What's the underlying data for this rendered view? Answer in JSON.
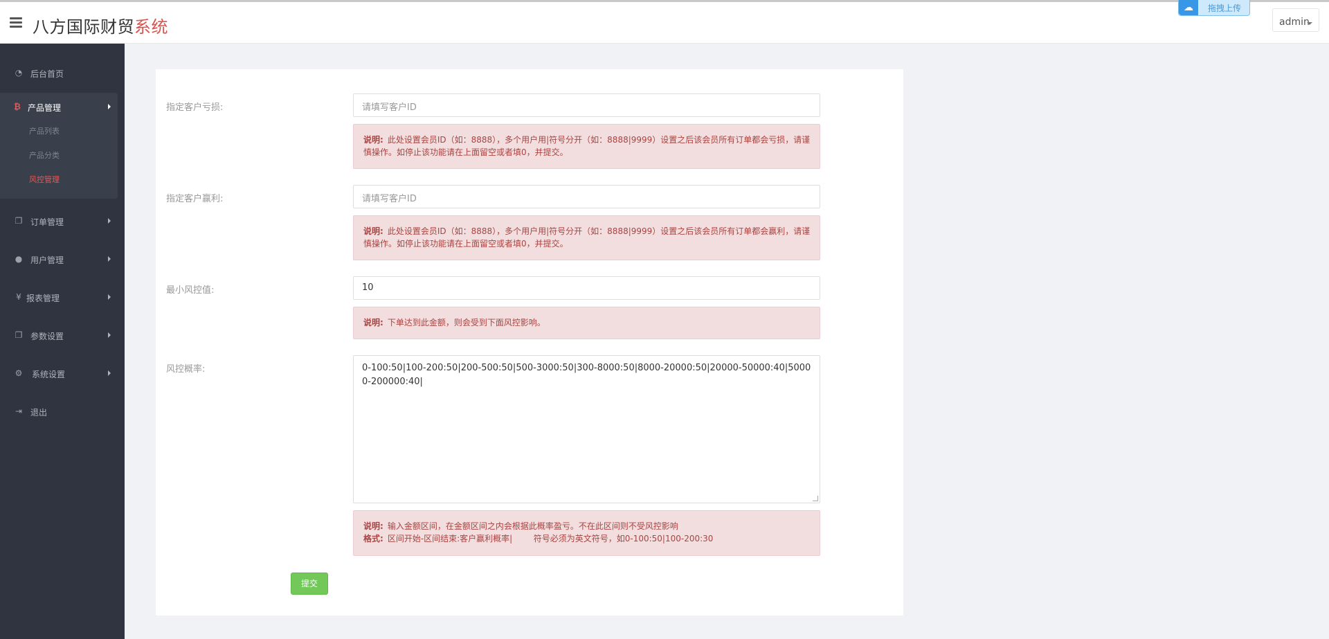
{
  "header": {
    "brand_main": "八方国际财贸",
    "brand_accent": "系统",
    "upload_label": "拖拽上传",
    "user_name": "admin"
  },
  "sidebar": {
    "items": [
      {
        "label": "后台首页",
        "icon": "dashboard-icon"
      },
      {
        "label": "订单管理",
        "icon": "copy-icon"
      },
      {
        "label": "用户管理",
        "icon": "user-icon"
      },
      {
        "label": "报表管理",
        "icon": "yen-icon"
      },
      {
        "label": "参数设置",
        "icon": "copy-icon"
      },
      {
        "label": "系统设置",
        "icon": "cogs-icon"
      },
      {
        "label": "退出",
        "icon": "sign-out-icon"
      }
    ],
    "active_group": {
      "label": "产品管理",
      "icon": "bitcoin-icon",
      "sub_items": [
        "产品列表",
        "产品分类",
        "风控管理"
      ],
      "active_sub": "风控管理"
    }
  },
  "form": {
    "loss_customer": {
      "label": "指定客户亏损:",
      "placeholder": "请填写客户ID",
      "note_title": "说明:",
      "note_text": "此处设置会员ID（如：8888），多个用户用|符号分开（如：8888|9999）设置之后该会员所有订单都会亏损，请谨慎操作。如停止该功能请在上面留空或者填0，并提交。"
    },
    "win_customer": {
      "label": "指定客户赢利:",
      "placeholder": "请填写客户ID",
      "note_title": "说明:",
      "note_text": "此处设置会员ID（如：8888），多个用户用|符号分开（如：8888|9999）设置之后该会员所有订单都会赢利，请谨慎操作。如停止该功能请在上面留空或者填0，并提交。"
    },
    "min_risk": {
      "label": "最小风控值:",
      "value": "10",
      "note_title": "说明:",
      "note_text": "下单达到此金额，则会受到下面风控影响。"
    },
    "risk_rate": {
      "label": "风控概率:",
      "value": "0-100:50|100-200:50|200-500:50|500-3000:50|300-8000:50|8000-20000:50|20000-50000:40|50000-200000:40|",
      "note_title": "说明:",
      "note_text": "输入金额区间，在金额区间之内会根据此概率盈亏。不在此区间则不受风控影响",
      "format_title": "格式:",
      "format_text": "区间开始-区间结束:客户赢利概率|        符号必须为英文符号，如0-100:50|100-200:30"
    },
    "submit_label": "提交"
  }
}
